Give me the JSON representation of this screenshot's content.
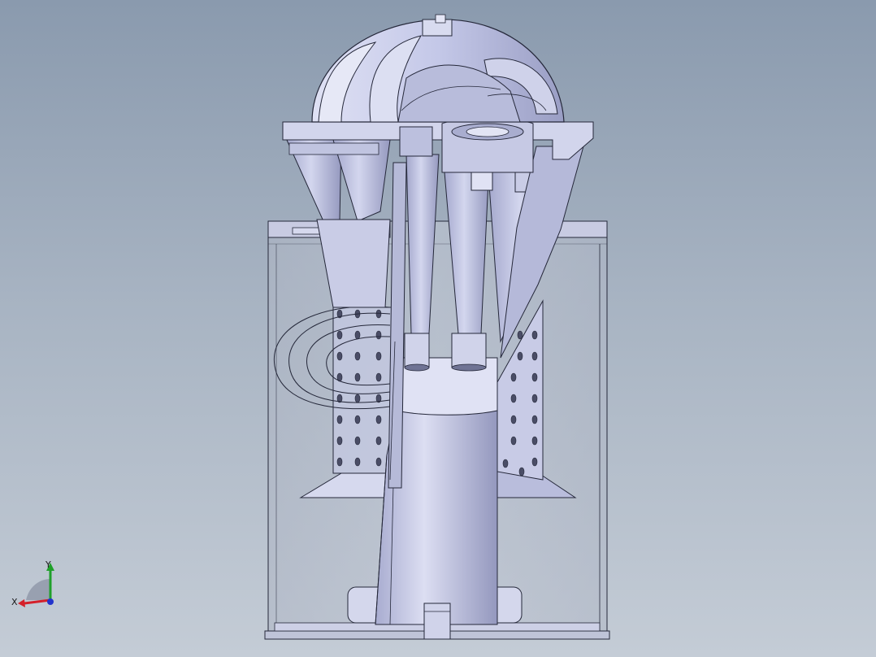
{
  "viewport": {
    "background_top": "#8a9aae",
    "background_bottom": "#c4ccd6",
    "model": "cyclone-separator-section-view"
  },
  "triad": {
    "x_label": "X",
    "y_label": "Y",
    "x_color": "#d4202a",
    "y_color": "#1fa02a",
    "z_color": "#2233cc"
  },
  "colors": {
    "part_fill": "#c4c8e6",
    "part_light": "#e4e6f6",
    "part_dark": "#8e92b8",
    "edge": "#25283a",
    "bin_fill": "#b8bfcc"
  }
}
